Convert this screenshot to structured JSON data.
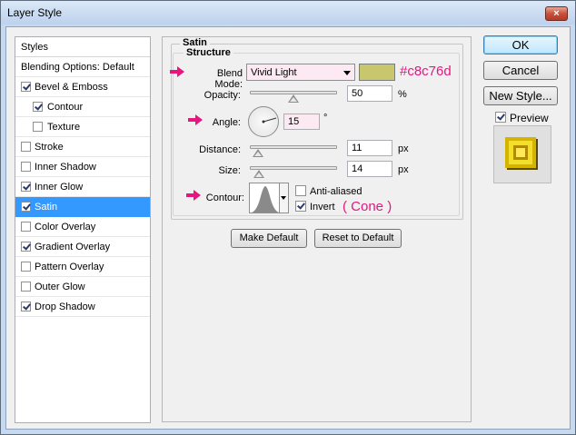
{
  "window": {
    "title": "Layer Style",
    "close_glyph": "×"
  },
  "sidebar": {
    "header": "Styles",
    "blending": "Blending Options: Default",
    "items": [
      {
        "label": "Bevel & Emboss",
        "checked": true
      },
      {
        "label": "Contour",
        "checked": true
      },
      {
        "label": "Texture",
        "checked": false
      },
      {
        "label": "Stroke",
        "checked": false
      },
      {
        "label": "Inner Shadow",
        "checked": false
      },
      {
        "label": "Inner Glow",
        "checked": true
      },
      {
        "label": "Satin",
        "checked": true,
        "selected": true
      },
      {
        "label": "Color Overlay",
        "checked": false
      },
      {
        "label": "Gradient Overlay",
        "checked": true
      },
      {
        "label": "Pattern Overlay",
        "checked": false
      },
      {
        "label": "Outer Glow",
        "checked": false
      },
      {
        "label": "Drop Shadow",
        "checked": true
      }
    ]
  },
  "satin": {
    "group_title": "Satin",
    "structure_title": "Structure",
    "blend_mode_label": "Blend Mode:",
    "blend_mode_value": "Vivid Light",
    "color": "#c8c76d",
    "color_annotation": "#c8c76d",
    "opacity_label": "Opacity:",
    "opacity_value": "50",
    "opacity_unit": "%",
    "angle_label": "Angle:",
    "angle_value": "15",
    "angle_unit": "°",
    "distance_label": "Distance:",
    "distance_value": "11",
    "distance_unit": "px",
    "size_label": "Size:",
    "size_value": "14",
    "size_unit": "px",
    "contour_label": "Contour:",
    "anti_aliased_label": "Anti-aliased",
    "anti_aliased": false,
    "invert_label": "Invert",
    "invert": true,
    "contour_annotation": "( Cone )",
    "make_default": "Make Default",
    "reset_default": "Reset to Default"
  },
  "right": {
    "ok": "OK",
    "cancel": "Cancel",
    "new_style": "New Style...",
    "preview_label": "Preview",
    "preview_checked": true
  },
  "colors": {
    "annotation": "#e8157f",
    "selection": "#3399ff",
    "satin_color": "#c8c76d"
  }
}
